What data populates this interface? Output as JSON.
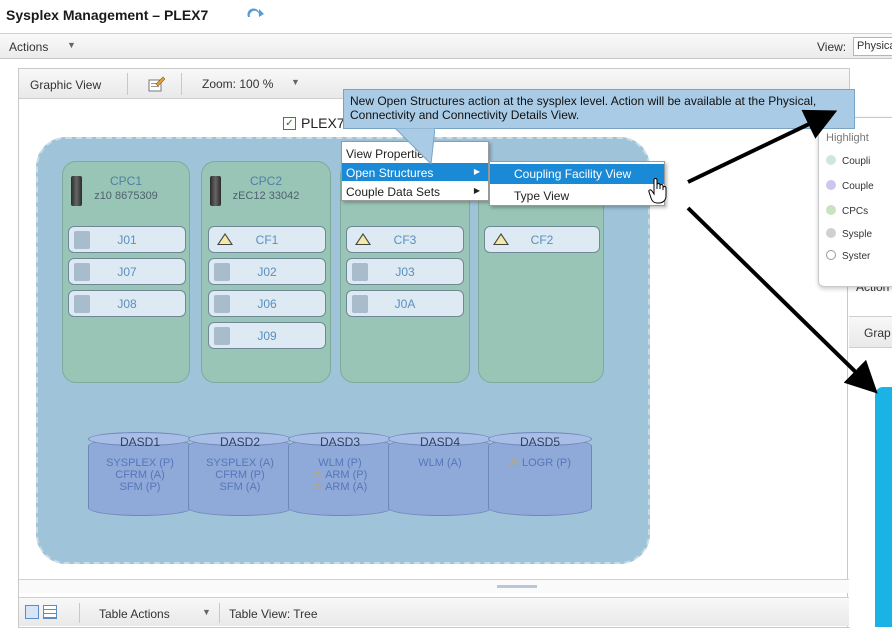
{
  "app": {
    "title": "Sysplex Management – PLEX7"
  },
  "actionsbar": {
    "actions": "Actions",
    "view_label": "View:",
    "view_value": "Physical"
  },
  "toolbar": {
    "graphic_view": "Graphic View",
    "zoom": "Zoom: 100 %"
  },
  "plex": {
    "name": "PLEX7",
    "checked": true
  },
  "cpcs": [
    {
      "name": "CPC1",
      "serial": "z10 8675309",
      "lpars": [
        "J01",
        "J07",
        "J08"
      ]
    },
    {
      "name": "CPC2",
      "serial": "zEC12 33042",
      "lpars": [
        "CF1",
        "J02",
        "J06",
        "J09"
      ]
    },
    {
      "name": "",
      "serial": "",
      "lpars": [
        "CF3",
        "J03",
        "J0A"
      ]
    },
    {
      "name": "",
      "serial": "",
      "lpars": [
        "CF2"
      ]
    }
  ],
  "dasd": [
    {
      "name": "DASD1",
      "lines": [
        "SYSPLEX (P)",
        "CFRM (A)",
        "SFM (P)"
      ]
    },
    {
      "name": "DASD2",
      "lines": [
        "SYSPLEX (A)",
        "CFRM (P)",
        "SFM (A)"
      ]
    },
    {
      "name": "DASD3",
      "lines": [
        "WLM (P)",
        "ARM (P)",
        "ARM (A)"
      ]
    },
    {
      "name": "DASD4",
      "lines": [
        "WLM (A)"
      ]
    },
    {
      "name": "DASD5",
      "lines": [
        "LOGR (P)"
      ]
    }
  ],
  "context_menu": {
    "items": [
      "View Properties",
      "Open Structures",
      "Couple Data Sets"
    ],
    "selected": "Open Structures"
  },
  "submenu": {
    "items": [
      "Coupling Facility View",
      "Type View"
    ],
    "selected": "Coupling Facility View"
  },
  "callout": {
    "text": "New Open Structures action at the sysplex level.  Action will be available at the Physical, Connectivity and Connectivity Details View."
  },
  "right_popup": {
    "header": "Highlight",
    "items": [
      {
        "label": "Coupli",
        "color": "#cfe8d8"
      },
      {
        "label": "Couple",
        "color": "#c9c6ef"
      },
      {
        "label": "CPCs",
        "color": "#c9e3c0"
      },
      {
        "label": "Sysple",
        "color": "#d0d0d0"
      },
      {
        "label": "Syster",
        "color": "#ffffff"
      }
    ]
  },
  "right_panel": {
    "actions": "Action",
    "graphic": "Grap"
  },
  "bottombar": {
    "table_actions": "Table Actions",
    "table_view": "Table View:  Tree"
  },
  "colors": {
    "accent": "#1a8ad6",
    "plex_bg": "#9fc3d8",
    "cpc_bg": "#98c5b5",
    "dasd": "#8fa9d8"
  }
}
